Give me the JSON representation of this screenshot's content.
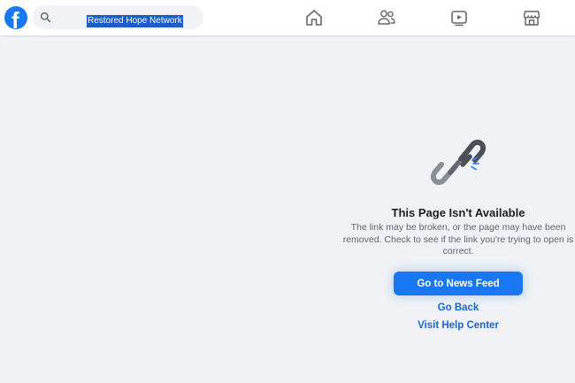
{
  "header": {
    "logo_letter": "f",
    "search": {
      "value": "Restored Hope Network"
    },
    "nav": [
      {
        "icon": "home-icon"
      },
      {
        "icon": "friends-icon"
      },
      {
        "icon": "watch-icon"
      },
      {
        "icon": "marketplace-icon"
      }
    ]
  },
  "error": {
    "icon": "broken-link-icon",
    "title": "This Page Isn't Available",
    "line1": "The link may be broken, or the page may have been",
    "line2": "removed. Check to see if the link you're trying to open is",
    "line3": "correct.",
    "primary_button": "Go to News Feed",
    "back_link": "Go Back",
    "help_link": "Visit Help Center"
  },
  "colors": {
    "brand": "#1877f2",
    "background": "#f0f2f5",
    "link": "#1b64d6"
  }
}
